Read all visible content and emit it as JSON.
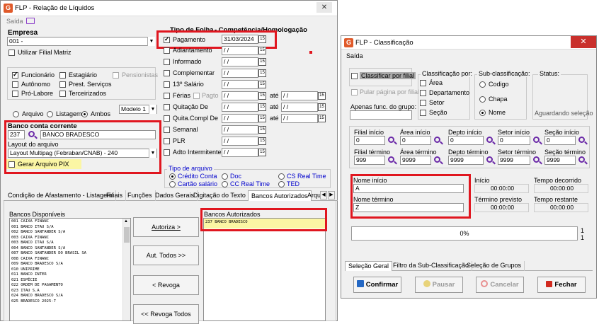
{
  "main": {
    "title": "FLP - Relação de Líquidos",
    "menu_saida": "Saída",
    "empresa_label": "Empresa",
    "empresa_value": "001 -",
    "utilizar_filial_matriz": "Utilizar Filial Matriz",
    "categorias": {
      "funcionario": "Funcionário",
      "autonomo": "Autônomo",
      "pro_labore": "Pró-Labore",
      "estagiario": "Estagiário",
      "prest_servicos": "Prest. Serviços",
      "terceirizados": "Terceirizados",
      "pensionistas": "Pensionistas"
    },
    "arquivo_opts": {
      "arquivo": "Arquivo",
      "listagem": "Listagem",
      "ambos": "Ambos"
    },
    "modelo": "Modelo 1",
    "banco_conta_corrente": "Banco conta corrente",
    "banco_codigo": "237",
    "banco_nome": "BANCO BRADESCO",
    "layout_label": "Layout do arquivo",
    "layout_value": "Layout Multipag (Febraban/CNAB) - 240",
    "gerar_pix": "Gerar Arquivo PIX",
    "tipo_folha_header": "Tipo de Folha",
    "competencia_header": "- Competência/Homologação",
    "folhas": {
      "pagamento": "Pagamento",
      "pagamento_data": "31/03/2024",
      "adiantamento": "Adiantamento",
      "informado": "Informado",
      "complementar": "Complementar",
      "decimo": "13º Salário",
      "ferias": "Férias",
      "pagto": "Pagto",
      "quitacao": "Quitação De",
      "quita_compl": "Quita.Compl De",
      "semanal": "Semanal",
      "plr": "PLR",
      "adto_intermitente": "Adto Intermitente",
      "ate": "até",
      "empty_date": "/ /"
    },
    "tipo_arquivo": {
      "label": "Tipo de arquivo",
      "credito_conta": "Crédito Conta",
      "cartao_salario": "Cartão salário",
      "doc": "Doc",
      "cc_real_time": "CC Real Time",
      "cs_real_time": "CS Real Time",
      "ted": "TED"
    },
    "tabs": [
      "Condição de Afastamento - Listagem",
      "Filiais",
      "Funções",
      "Dados Gerais",
      "Digitação do Texto",
      "Bancos Autorizados",
      "Arqu"
    ],
    "bancos_disponiveis_label": "Bancos Disponíveis",
    "bancos_disponiveis": [
      "001 CAIXA FINANC",
      "001 BANCO ITAU S/A",
      "002 BANCO SANTANDER S/A",
      "003 CAIXA FINANC",
      "003 BANCO ITAU S/A",
      "004 BANCO SANTANDER S/A",
      "007 BANCO SANTANDER DO BRASIL SA",
      "008 CAIXA FINANC",
      "009 BANCO BRADESCO S/A",
      "010 UNIPRIME",
      "011 BANCO INTER",
      "021 ESPÉCIE",
      "022 ORDEM DE PAGAMENTO",
      "023 ITAU S.A",
      "024 BANCO BRADESCO S/A",
      "025 BRADESCO 2025-7"
    ],
    "buttons": {
      "autoriza": "Autoriza >",
      "aut_todos": "Aut. Todos >>",
      "revoga": "< Revoga",
      "revoga_todos": "<< Revoga Todos"
    },
    "bancos_autorizados_label": "Bancos Autorizados",
    "bancos_autorizados": [
      "237 BANCO BRADESCO"
    ]
  },
  "classif": {
    "title": "FLP - Classificação",
    "menu_saida": "Saída",
    "classificar_por_filial": "Classificar por filial",
    "pular_pagina": "Pular página por filial",
    "apenas_func": "Apenas func. do grupo:",
    "classificacao_por": "Classificação por:",
    "area": "Área",
    "departamento": "Departamento",
    "setor": "Setor",
    "secao": "Seção",
    "sub_classificacao": "Sub-classificação:",
    "codigo": "Codigo",
    "chapa": "Chapa",
    "nome": "Nome",
    "status_label": "Status:",
    "status_value": "Aguardando seleção",
    "filial_inicio": "Filial início",
    "filial_inicio_val": "0",
    "filial_termino": "Filial término",
    "filial_termino_val": "999",
    "area_inicio": "Área início",
    "area_inicio_val": "0",
    "area_termino": "Área término",
    "area_termino_val": "9999",
    "depto_inicio": "Depto início",
    "depto_inicio_val": "0",
    "depto_termino": "Depto término",
    "depto_termino_val": "9999",
    "setor_inicio": "Setor início",
    "setor_inicio_val": "0",
    "setor_termino": "Setor término",
    "setor_termino_val": "9999",
    "secao_inicio": "Seção início",
    "secao_inicio_val": "0",
    "secao_termino": "Seção término",
    "secao_termino_val": "9999",
    "nome_inicio": "Nome início",
    "nome_inicio_val": "A",
    "nome_termino": "Nome término",
    "nome_termino_val": "Z",
    "inicio": "Início",
    "inicio_val": "00:00:00",
    "termino_previsto": "Término previsto",
    "termino_previsto_val": "00:00:00",
    "tempo_decorrido": "Tempo decorrido",
    "tempo_decorrido_val": "00:00:00",
    "tempo_restante": "Tempo restante",
    "tempo_restante_val": "00:00:00",
    "progress_text": "0%",
    "progress_value": 0,
    "side_1": "1",
    "side_2": "1",
    "tabs": [
      "Seleção Geral",
      "Filtro da Sub-Classificação",
      "Seleção de Grupos"
    ],
    "buttons": {
      "confirmar": "Confirmar",
      "pausar": "Pausar",
      "cancelar": "Cancelar",
      "fechar": "Fechar"
    }
  }
}
